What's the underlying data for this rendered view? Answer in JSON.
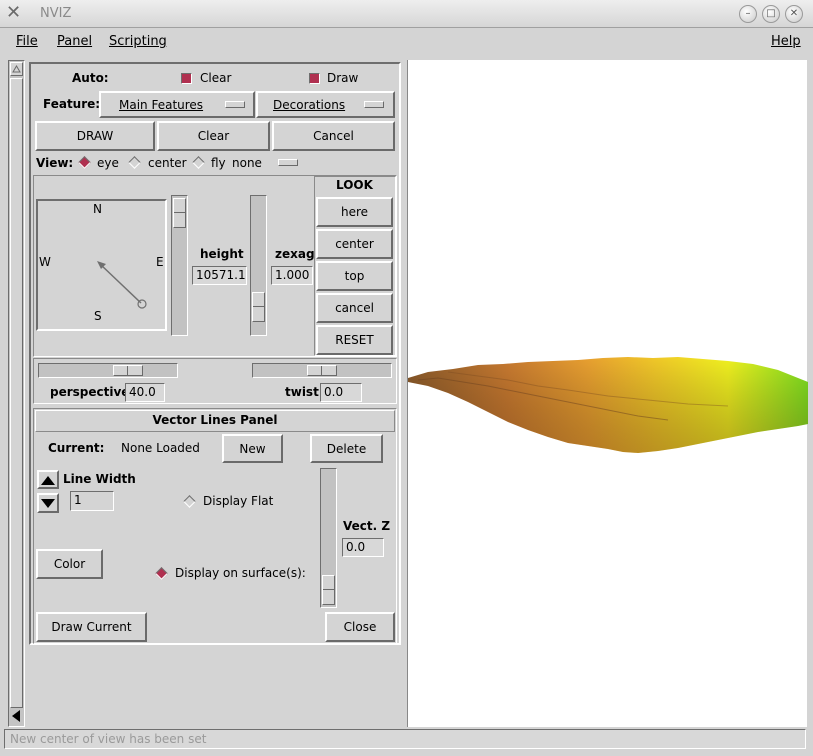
{
  "window": {
    "title": "NVIZ"
  },
  "menubar": {
    "file": "File",
    "panel": "Panel",
    "scripting": "Scripting",
    "help": "Help"
  },
  "auto": {
    "label": "Auto:",
    "clear_label": "Clear",
    "draw_label": "Draw",
    "clear_checked": true,
    "draw_checked": true
  },
  "feature": {
    "label": "Feature:",
    "main": "Main Features",
    "decorations": "Decorations"
  },
  "actions": {
    "draw": "DRAW",
    "clear": "Clear",
    "cancel": "Cancel"
  },
  "view": {
    "label": "View:",
    "options": [
      "eye",
      "center",
      "fly"
    ],
    "selected": "eye",
    "fly_mode": "none"
  },
  "compass": {
    "n": "N",
    "e": "E",
    "w": "W",
    "s": "S"
  },
  "height": {
    "label": "height",
    "value": "10571.10"
  },
  "zexag": {
    "label": "zexag",
    "value": "1.000"
  },
  "look": {
    "title": "LOOK",
    "here": "here",
    "center": "center",
    "top": "top",
    "cancel": "cancel",
    "reset": "RESET"
  },
  "perspective": {
    "label": "perspective",
    "value": "40.0"
  },
  "twist": {
    "label": "twist",
    "value": "0.0"
  },
  "vector_panel": {
    "title": "Vector Lines Panel",
    "current_label": "Current:",
    "current_value": "None Loaded",
    "new": "New",
    "delete": "Delete",
    "line_width_label": "Line Width",
    "line_width_value": "1",
    "display_flat": "Display Flat",
    "vect_z_label": "Vect. Z",
    "vect_z_value": "0.0",
    "color": "Color",
    "display_on_surface": "Display on surface(s):",
    "draw_current": "Draw Current",
    "close": "Close"
  },
  "status": {
    "text": "New center of view has been set"
  },
  "colors": {
    "accent": "#b03050",
    "background": "#d4d4d4",
    "terrain_low": "#8a5a2a",
    "terrain_mid": "#e8a030",
    "terrain_high": "#f0f020",
    "terrain_peak": "#80e020"
  }
}
